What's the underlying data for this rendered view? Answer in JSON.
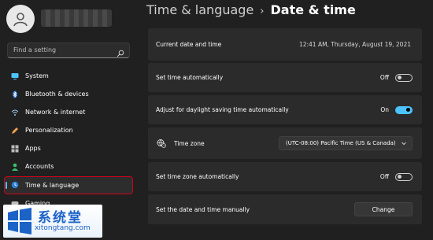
{
  "sidebar": {
    "search_placeholder": "Find a setting",
    "items": [
      {
        "label": "System",
        "icon": "monitor-icon"
      },
      {
        "label": "Bluetooth & devices",
        "icon": "bluetooth-icon"
      },
      {
        "label": "Network & internet",
        "icon": "wifi-icon"
      },
      {
        "label": "Personalization",
        "icon": "pencil-icon"
      },
      {
        "label": "Apps",
        "icon": "apps-grid-icon"
      },
      {
        "label": "Accounts",
        "icon": "person-icon"
      },
      {
        "label": "Time & language",
        "icon": "globe-clock-icon",
        "active": true
      },
      {
        "label": "Gaming",
        "icon": "gamepad-icon"
      }
    ]
  },
  "header": {
    "parent": "Time & language",
    "separator": "›",
    "current": "Date & time"
  },
  "settings": {
    "current_datetime": {
      "label": "Current date and time",
      "value": "12:41 AM, Thursday, August 19, 2021"
    },
    "set_time_auto": {
      "label": "Set time automatically",
      "state": "Off"
    },
    "daylight_saving": {
      "label": "Adjust for daylight saving time automatically",
      "state": "On"
    },
    "time_zone": {
      "label": "Time zone",
      "value": "(UTC-08:00) Pacific Time (US & Canada)"
    },
    "set_timezone_auto": {
      "label": "Set time zone automatically",
      "state": "Off"
    },
    "set_manually": {
      "label": "Set the date and time manually",
      "button": "Change"
    }
  },
  "watermark": {
    "text_cn": "系统堂",
    "text_en": "xitongtang.com"
  },
  "colors": {
    "accent": "#4cc2ff",
    "highlight_border": "#d0021b",
    "background": "#202020",
    "card": "#2b2b2b"
  }
}
